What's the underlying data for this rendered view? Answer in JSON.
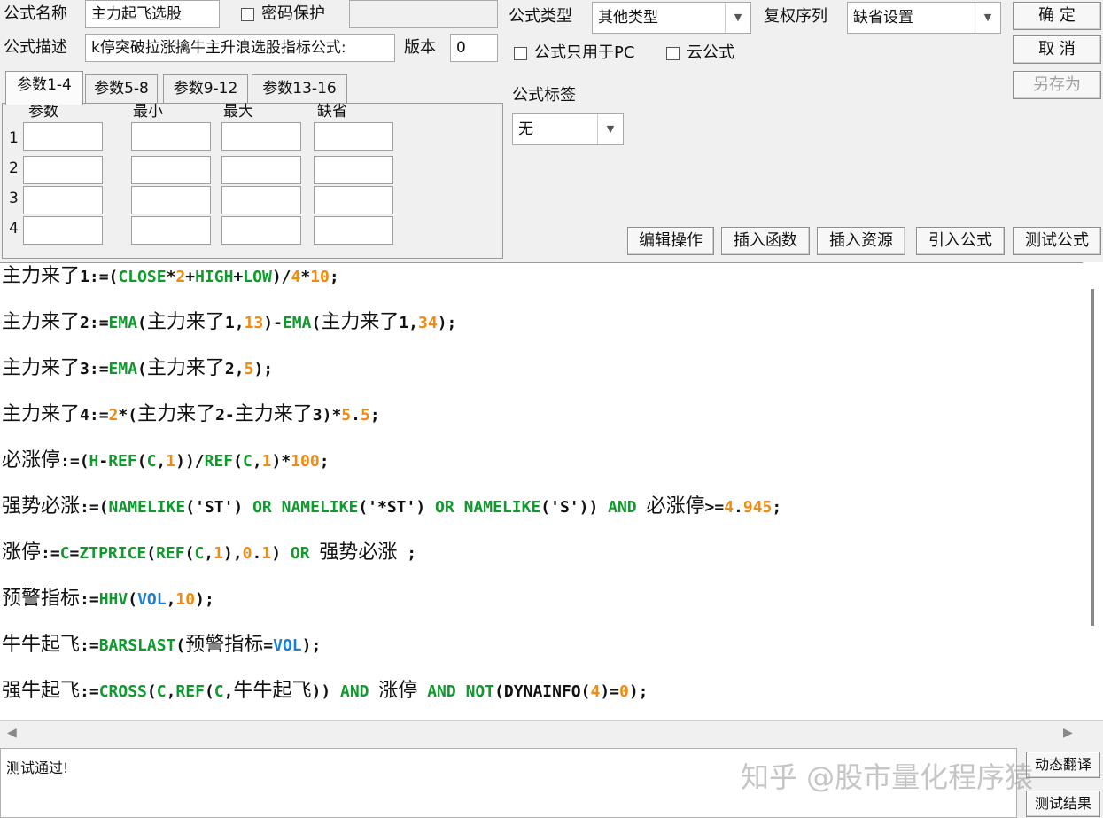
{
  "form": {
    "name_label": "公式名称",
    "name_value": "主力起飞选股",
    "password_label": "密码保护",
    "desc_label": "公式描述",
    "desc_value": "k停突破拉涨擒牛主升浪选股指标公式:",
    "version_label": "版本",
    "version_value": "0",
    "type_label": "公式类型",
    "type_value": "其他类型",
    "restore_label": "复权序列",
    "restore_value": "缺省设置",
    "pc_only_label": "公式只用于PC",
    "cloud_label": "云公式",
    "tag_label": "公式标签",
    "tag_value": "无"
  },
  "buttons": {
    "ok": "确  定",
    "cancel": "取  消",
    "save_as": "另存为",
    "edit_ops": "编辑操作",
    "insert_func": "插入函数",
    "insert_res": "插入资源",
    "import_formula": "引入公式",
    "test_formula": "测试公式",
    "translate": "动态翻译",
    "test_result": "测试结果"
  },
  "params": {
    "tabs": [
      "参数1-4",
      "参数5-8",
      "参数9-12",
      "参数13-16"
    ],
    "columns": [
      "参数",
      "最小",
      "最大",
      "缺省"
    ],
    "rows": [
      "1",
      "2",
      "3",
      "4"
    ]
  },
  "code_lines": [
    [
      {
        "t": "主力来了",
        "c": "cn"
      },
      {
        "t": "1:=(",
        "c": "d"
      },
      {
        "t": "CLOSE",
        "c": "g"
      },
      {
        "t": "*",
        "c": "d"
      },
      {
        "t": "2",
        "c": "o"
      },
      {
        "t": "+",
        "c": "d"
      },
      {
        "t": "HIGH",
        "c": "g"
      },
      {
        "t": "+",
        "c": "d"
      },
      {
        "t": "LOW",
        "c": "g"
      },
      {
        "t": ")/",
        "c": "d"
      },
      {
        "t": "4",
        "c": "o"
      },
      {
        "t": "*",
        "c": "d"
      },
      {
        "t": "10",
        "c": "o"
      },
      {
        "t": ";",
        "c": "d"
      }
    ],
    [
      {
        "t": "主力来了",
        "c": "cn"
      },
      {
        "t": "2:=",
        "c": "d"
      },
      {
        "t": "EMA",
        "c": "g"
      },
      {
        "t": "(",
        "c": "d"
      },
      {
        "t": "主力来了",
        "c": "cn"
      },
      {
        "t": "1,",
        "c": "d"
      },
      {
        "t": "13",
        "c": "o"
      },
      {
        "t": ")-",
        "c": "d"
      },
      {
        "t": "EMA",
        "c": "g"
      },
      {
        "t": "(",
        "c": "d"
      },
      {
        "t": "主力来了",
        "c": "cn"
      },
      {
        "t": "1,",
        "c": "d"
      },
      {
        "t": "34",
        "c": "o"
      },
      {
        "t": ");",
        "c": "d"
      }
    ],
    [
      {
        "t": "主力来了",
        "c": "cn"
      },
      {
        "t": "3:=",
        "c": "d"
      },
      {
        "t": "EMA",
        "c": "g"
      },
      {
        "t": "(",
        "c": "d"
      },
      {
        "t": "主力来了",
        "c": "cn"
      },
      {
        "t": "2,",
        "c": "d"
      },
      {
        "t": "5",
        "c": "o"
      },
      {
        "t": ");",
        "c": "d"
      }
    ],
    [
      {
        "t": "主力来了",
        "c": "cn"
      },
      {
        "t": "4:=",
        "c": "d"
      },
      {
        "t": "2",
        "c": "o"
      },
      {
        "t": "*(",
        "c": "d"
      },
      {
        "t": "主力来了",
        "c": "cn"
      },
      {
        "t": "2-",
        "c": "d"
      },
      {
        "t": "主力来了",
        "c": "cn"
      },
      {
        "t": "3)*",
        "c": "d"
      },
      {
        "t": "5",
        "c": "o"
      },
      {
        "t": ".",
        "c": "d"
      },
      {
        "t": "5",
        "c": "o"
      },
      {
        "t": ";",
        "c": "d"
      }
    ],
    [
      {
        "t": "必涨停",
        "c": "cn"
      },
      {
        "t": ":=(",
        "c": "d"
      },
      {
        "t": "H",
        "c": "g"
      },
      {
        "t": "-",
        "c": "d"
      },
      {
        "t": "REF",
        "c": "g"
      },
      {
        "t": "(",
        "c": "d"
      },
      {
        "t": "C",
        "c": "g"
      },
      {
        "t": ",",
        "c": "d"
      },
      {
        "t": "1",
        "c": "o"
      },
      {
        "t": "))/",
        "c": "d"
      },
      {
        "t": "REF",
        "c": "g"
      },
      {
        "t": "(",
        "c": "d"
      },
      {
        "t": "C",
        "c": "g"
      },
      {
        "t": ",",
        "c": "d"
      },
      {
        "t": "1",
        "c": "o"
      },
      {
        "t": ")*",
        "c": "d"
      },
      {
        "t": "100",
        "c": "o"
      },
      {
        "t": ";",
        "c": "d"
      }
    ],
    [
      {
        "t": "强势必涨",
        "c": "cn"
      },
      {
        "t": ":=(",
        "c": "d"
      },
      {
        "t": "NAMELIKE",
        "c": "g"
      },
      {
        "t": "('ST') ",
        "c": "d"
      },
      {
        "t": "OR",
        "c": "g"
      },
      {
        "t": " ",
        "c": "d"
      },
      {
        "t": "NAMELIKE",
        "c": "g"
      },
      {
        "t": "('*ST') ",
        "c": "d"
      },
      {
        "t": "OR",
        "c": "g"
      },
      {
        "t": " ",
        "c": "d"
      },
      {
        "t": "NAMELIKE",
        "c": "g"
      },
      {
        "t": "('S')) ",
        "c": "d"
      },
      {
        "t": "AND",
        "c": "g"
      },
      {
        "t": " ",
        "c": "d"
      },
      {
        "t": "必涨停",
        "c": "cn"
      },
      {
        "t": ">=",
        "c": "d"
      },
      {
        "t": "4",
        "c": "o"
      },
      {
        "t": ".",
        "c": "d"
      },
      {
        "t": "945",
        "c": "o"
      },
      {
        "t": ";",
        "c": "d"
      }
    ],
    [
      {
        "t": "涨停",
        "c": "cn"
      },
      {
        "t": ":=",
        "c": "d"
      },
      {
        "t": "C",
        "c": "g"
      },
      {
        "t": "=",
        "c": "d"
      },
      {
        "t": "ZTPRICE",
        "c": "g"
      },
      {
        "t": "(",
        "c": "d"
      },
      {
        "t": "REF",
        "c": "g"
      },
      {
        "t": "(",
        "c": "d"
      },
      {
        "t": "C",
        "c": "g"
      },
      {
        "t": ",",
        "c": "d"
      },
      {
        "t": "1",
        "c": "o"
      },
      {
        "t": "),",
        "c": "d"
      },
      {
        "t": "0",
        "c": "o"
      },
      {
        "t": ".",
        "c": "d"
      },
      {
        "t": "1",
        "c": "o"
      },
      {
        "t": ") ",
        "c": "d"
      },
      {
        "t": "OR",
        "c": "g"
      },
      {
        "t": " ",
        "c": "d"
      },
      {
        "t": "强势必涨",
        "c": "cn"
      },
      {
        "t": " ;",
        "c": "d"
      }
    ],
    [
      {
        "t": "预警指标",
        "c": "cn"
      },
      {
        "t": ":=",
        "c": "d"
      },
      {
        "t": "HHV",
        "c": "g"
      },
      {
        "t": "(",
        "c": "d"
      },
      {
        "t": "VOL",
        "c": "b"
      },
      {
        "t": ",",
        "c": "d"
      },
      {
        "t": "10",
        "c": "o"
      },
      {
        "t": ");",
        "c": "d"
      }
    ],
    [
      {
        "t": "牛牛起飞",
        "c": "cn"
      },
      {
        "t": ":=",
        "c": "d"
      },
      {
        "t": "BARSLAST",
        "c": "g"
      },
      {
        "t": "(",
        "c": "d"
      },
      {
        "t": "预警指标",
        "c": "cn"
      },
      {
        "t": "=",
        "c": "d"
      },
      {
        "t": "VOL",
        "c": "b"
      },
      {
        "t": ");",
        "c": "d"
      }
    ],
    [
      {
        "t": "强牛起飞",
        "c": "cn"
      },
      {
        "t": ":=",
        "c": "d"
      },
      {
        "t": "CROSS",
        "c": "g"
      },
      {
        "t": "(",
        "c": "d"
      },
      {
        "t": "C",
        "c": "g"
      },
      {
        "t": ",",
        "c": "d"
      },
      {
        "t": "REF",
        "c": "g"
      },
      {
        "t": "(",
        "c": "d"
      },
      {
        "t": "C",
        "c": "g"
      },
      {
        "t": ",",
        "c": "d"
      },
      {
        "t": "牛牛起飞",
        "c": "cn"
      },
      {
        "t": ")) ",
        "c": "d"
      },
      {
        "t": "AND",
        "c": "g"
      },
      {
        "t": " ",
        "c": "d"
      },
      {
        "t": "涨停",
        "c": "cn"
      },
      {
        "t": " ",
        "c": "d"
      },
      {
        "t": "AND",
        "c": "g"
      },
      {
        "t": " ",
        "c": "d"
      },
      {
        "t": "NOT",
        "c": "g"
      },
      {
        "t": "(DYNAINFO(",
        "c": "d"
      },
      {
        "t": "4",
        "c": "o"
      },
      {
        "t": ")=",
        "c": "d"
      },
      {
        "t": "0",
        "c": "o"
      },
      {
        "t": ");",
        "c": "d"
      }
    ]
  ],
  "colors": {
    "g": "#0e9a2c",
    "o": "#f28a10",
    "b": "#1c7fd0",
    "d": "#111111",
    "cn": "#111111"
  },
  "status_text": "测试通过!",
  "watermark": "知乎 @股市量化程序猿",
  "icons": {
    "dropdown": "▼",
    "scroll_left": "◀",
    "scroll_right": "▶"
  }
}
